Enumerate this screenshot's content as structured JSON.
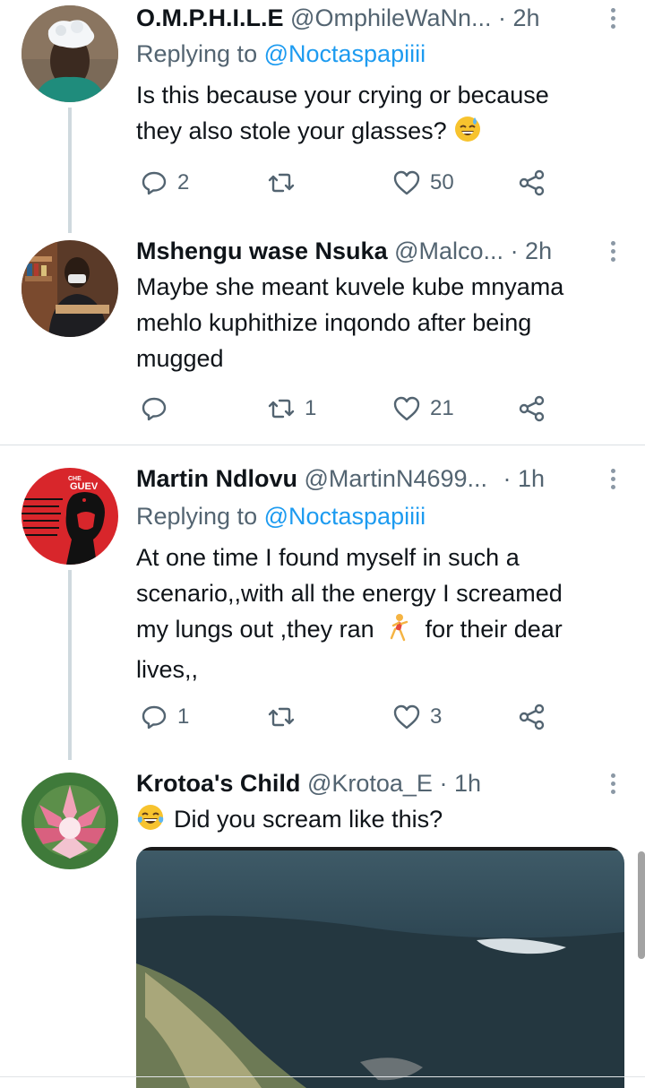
{
  "tweets": [
    {
      "name": "O.M.P.H.I.L.E",
      "handle": "@OmphileWaNn...",
      "time": "· 2h",
      "replying_prefix": "Replying to ",
      "replying_to": "@Noctaspapiiii",
      "lines": [
        "Is this because your crying or because",
        "they also stole your glasses?"
      ],
      "emoji": "sweat-smile-emoji",
      "counts": {
        "replies": "2",
        "retweets": "",
        "likes": "50"
      }
    },
    {
      "name": "Mshengu wase Nsuka",
      "handle": "@Malco...",
      "time": "· 2h",
      "lines": [
        "Maybe she meant kuvele kube mnyama",
        "mehlo kuphithize inqondo after being",
        "mugged"
      ],
      "counts": {
        "replies": "",
        "retweets": "1",
        "likes": "21"
      }
    },
    {
      "name": "Martin Ndlovu",
      "handle": "@MartinN4699...",
      "time": "· 1h",
      "replying_prefix": "Replying to ",
      "replying_to": "@Noctaspapiiii",
      "lines": [
        "At one time I found myself in such a",
        "scenario,,with all the energy I screamed",
        "my lungs out ,they ran",
        "for their dear",
        "lives,,"
      ],
      "emoji": "running-woman-emoji",
      "avatar_text": "CHE GUEV",
      "counts": {
        "replies": "1",
        "retweets": "",
        "likes": "3"
      }
    },
    {
      "name": "Krotoa's Child",
      "handle": "@Krotoa_E",
      "time": "· 1h",
      "lines": [
        "Did you scream like this?"
      ],
      "emoji": "tears-of-joy-emoji"
    }
  ],
  "icons": {
    "reply": "reply-icon",
    "retweet": "retweet-icon",
    "like": "heart-icon",
    "share": "share-icon",
    "more": "more-dots-icon"
  },
  "colors": {
    "text": "#0f1419",
    "secondary": "#536471",
    "accent": "#1d9bf0",
    "thread_line": "#cfd9de"
  }
}
